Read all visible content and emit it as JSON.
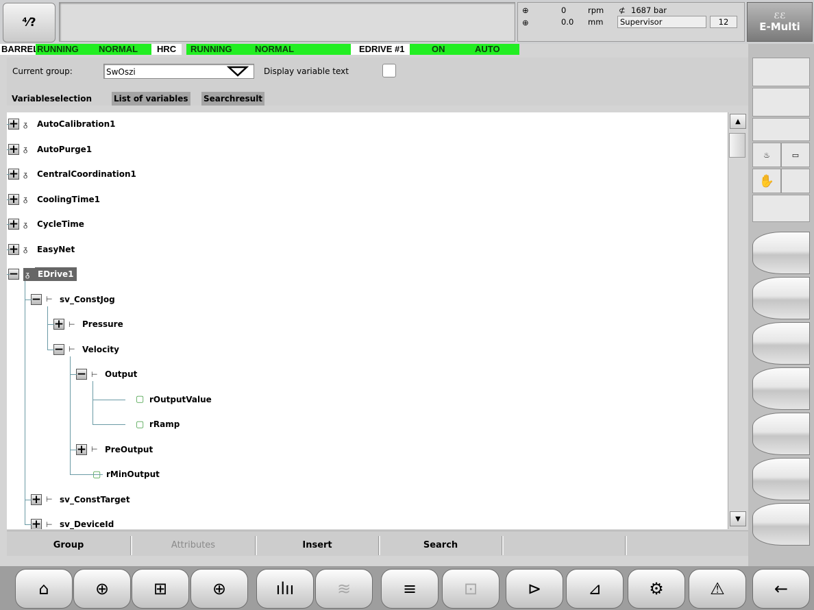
{
  "header": {
    "help_icon": "help-icon",
    "help_glyph": "⁴⁄?",
    "message": "",
    "rpm_value": "0",
    "rpm_unit": "rpm",
    "mm_value": "0.0",
    "mm_unit": "mm",
    "pressure": "1687 bar",
    "user": "Supervisor",
    "user_level": "12",
    "logo_text": "E-Multi"
  },
  "statusline": {
    "barrel_label": "BARREL",
    "barrel_state": "RUNNING",
    "barrel_mode": "NORMAL",
    "hrc_label": "HRC",
    "hrc_state": "RUNNING",
    "hrc_mode": "NORMAL",
    "edrive_label": "EDRIVE #1",
    "edrive_state": "ON",
    "edrive_mode": "AUTO"
  },
  "controls": {
    "current_group_label": "Current group:",
    "current_group_value": "SwOszi",
    "display_text_label": "Display variable text",
    "display_text_checked": false
  },
  "tabs": [
    {
      "label": "Variableselection",
      "active": true
    },
    {
      "label": "List of variables",
      "active": false
    },
    {
      "label": "Searchresult",
      "active": false
    }
  ],
  "tree": [
    {
      "label": "AutoCalibration1",
      "depth": 0,
      "state": "+",
      "kind": "group"
    },
    {
      "label": "AutoPurge1",
      "depth": 0,
      "state": "+",
      "kind": "group"
    },
    {
      "label": "CentralCoordination1",
      "depth": 0,
      "state": "+",
      "kind": "group"
    },
    {
      "label": "CoolingTime1",
      "depth": 0,
      "state": "+",
      "kind": "group"
    },
    {
      "label": "CycleTime",
      "depth": 0,
      "state": "+",
      "kind": "group"
    },
    {
      "label": "EasyNet",
      "depth": 0,
      "state": "+",
      "kind": "group"
    },
    {
      "label": "EDrive1",
      "depth": 0,
      "state": "−",
      "kind": "group",
      "selected": true
    },
    {
      "label": "sv_ConstJog",
      "depth": 1,
      "state": "−",
      "kind": "struct"
    },
    {
      "label": "Pressure",
      "depth": 2,
      "state": "+",
      "kind": "struct"
    },
    {
      "label": "Velocity",
      "depth": 2,
      "state": "−",
      "kind": "struct"
    },
    {
      "label": "Output",
      "depth": 3,
      "state": "−",
      "kind": "struct"
    },
    {
      "label": "rOutputValue",
      "depth": 4,
      "state": "",
      "kind": "var"
    },
    {
      "label": "rRamp",
      "depth": 4,
      "state": "",
      "kind": "var"
    },
    {
      "label": "PreOutput",
      "depth": 3,
      "state": "+",
      "kind": "struct"
    },
    {
      "label": "rMinOutput",
      "depth": 3,
      "state": "",
      "kind": "var"
    },
    {
      "label": "sv_ConstTarget",
      "depth": 1,
      "state": "+",
      "kind": "struct"
    },
    {
      "label": "sv_DeviceId",
      "depth": 1,
      "state": "+",
      "kind": "struct"
    }
  ],
  "bottom_buttons": [
    {
      "label": "Group",
      "enabled": true
    },
    {
      "label": "Attributes",
      "enabled": false
    },
    {
      "label": "Insert",
      "enabled": true
    },
    {
      "label": "Search",
      "enabled": true
    },
    {
      "label": "",
      "enabled": false
    },
    {
      "label": "",
      "enabled": false
    }
  ],
  "nav": [
    {
      "icon": "home-icon",
      "glyph": "⌂",
      "enabled": true
    },
    {
      "icon": "injection-unit-icon",
      "glyph": "⊕",
      "enabled": true
    },
    {
      "icon": "mold-icon",
      "glyph": "⊞",
      "enabled": true
    },
    {
      "icon": "nozzle-icon",
      "glyph": "⊕",
      "enabled": true
    },
    {
      "icon": "temperature-zones-icon",
      "glyph": "ılıı",
      "enabled": true
    },
    {
      "icon": "hot-runner-icon",
      "glyph": "≋",
      "enabled": false
    },
    {
      "icon": "list-icon",
      "glyph": "≡",
      "enabled": true
    },
    {
      "icon": "robot-icon",
      "glyph": "⊡",
      "enabled": false
    },
    {
      "icon": "ejector-icon",
      "glyph": "⊳",
      "enabled": true
    },
    {
      "icon": "graph-icon",
      "glyph": "⊿",
      "enabled": true
    },
    {
      "icon": "settings-icon",
      "glyph": "⚙",
      "enabled": true
    },
    {
      "icon": "alarm-icon",
      "glyph": "⚠",
      "enabled": true
    },
    {
      "icon": "back-arrow-icon",
      "glyph": "←",
      "enabled": true
    }
  ],
  "colors": {
    "status_green": "#22ee22",
    "tree_line": "#6a9aa5",
    "selected_bg": "#666666"
  }
}
